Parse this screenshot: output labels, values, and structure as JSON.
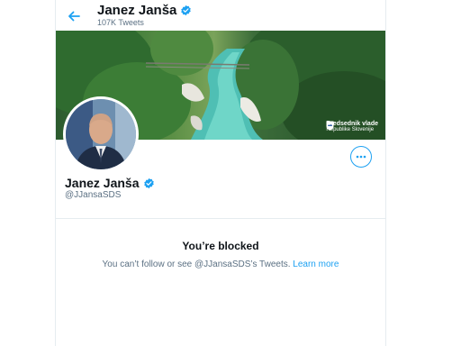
{
  "header": {
    "name": "Janez Janša",
    "tweet_count": "107K Tweets"
  },
  "banner": {
    "watermark_line1": "Predsednik vlade",
    "watermark_line2": "Republike Slovenije"
  },
  "profile": {
    "name": "Janez Janša",
    "handle": "@JJansaSDS"
  },
  "blocked": {
    "title": "You’re blocked",
    "message": "You can’t follow or see @JJansaSDS’s Tweets.",
    "link": "Learn more"
  },
  "colors": {
    "accent": "#1da1f2",
    "secondary_text": "#5b7083",
    "border": "#e6ecf0"
  },
  "icons": [
    "back-arrow-icon",
    "verified-badge-icon",
    "more-options-icon",
    "government-crest-icon"
  ]
}
